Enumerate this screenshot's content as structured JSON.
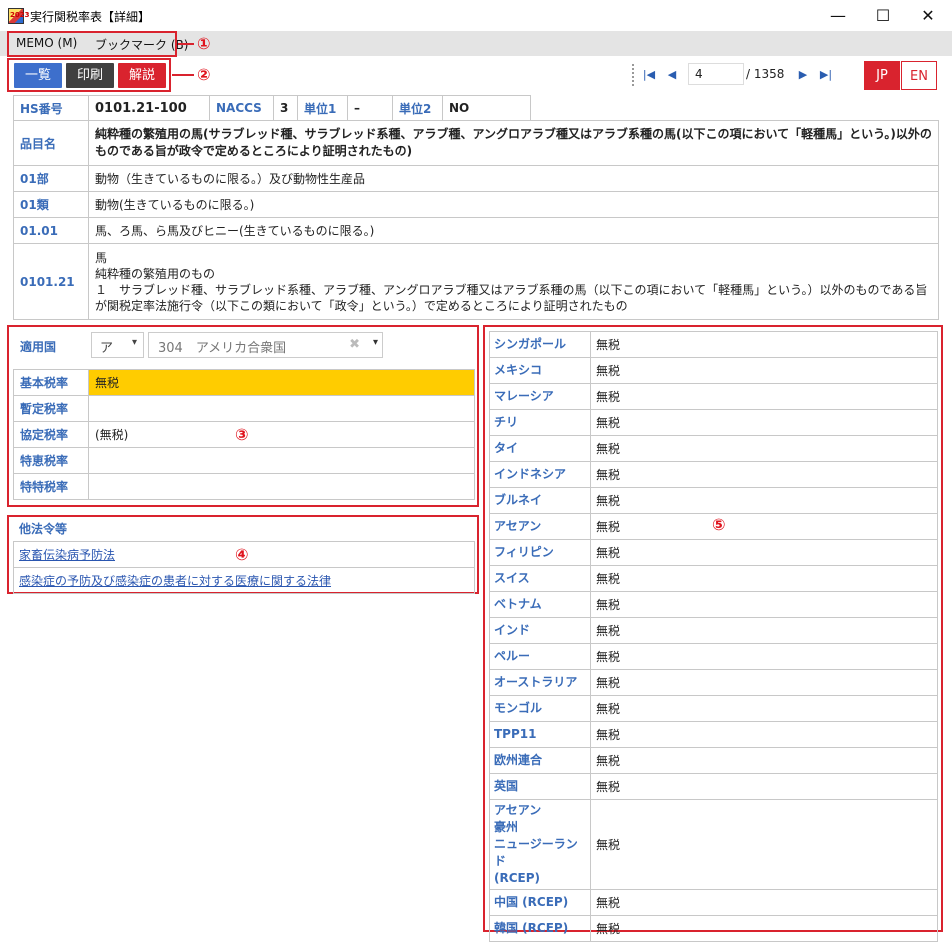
{
  "window": {
    "title": "実行関税率表【詳細】",
    "icon_text": "2023",
    "minimize": "—",
    "maximize": "☐",
    "close": "✕"
  },
  "menu": {
    "memo": "MEMO (M)",
    "bookmark": "ブックマーク (B)"
  },
  "callouts": {
    "c1": "①",
    "c2": "②",
    "c3": "③",
    "c4": "④",
    "c5": "⑤"
  },
  "toolbar": {
    "list": "一覧",
    "print": "印刷",
    "explain": "解説"
  },
  "pager": {
    "current": "4",
    "total": "/ 1358",
    "first": "|◀",
    "prev": "◀",
    "next": "▶",
    "last": "▶|"
  },
  "lang": {
    "jp": "JP",
    "en": "EN"
  },
  "header": {
    "hs_label": "HS番号",
    "hs_value": "0101.21-100",
    "naccs_label": "NACCS",
    "naccs_value": "3",
    "unit1_label": "単位1",
    "unit1_value": "–",
    "unit2_label": "単位2",
    "unit2_value": "NO",
    "item_label": "品目名",
    "item_value": "純粋種の繁殖用の馬(サラブレッド種、サラブレッド系種、アラブ種、アングロアラブ種又はアラブ系種の馬(以下この項において「軽種馬」という。)以外のものである旨が政令で定めるところにより証明されたもの)",
    "rows": [
      {
        "label": "01部",
        "value": "動物（生きているものに限る。）及び動物性生産品"
      },
      {
        "label": "01類",
        "value": "動物(生きているものに限る。)"
      },
      {
        "label": "01.01",
        "value": "馬、ろ馬、ら馬及びヒニー(生きているものに限る。)"
      }
    ],
    "code_label": "0101.21",
    "code_lines": [
      "馬",
      "純粋種の繁殖用のもの",
      "１　サラブレッド種、サラブレッド系種、アラブ種、アングロアラブ種又はアラブ系種の馬（以下この項において「軽種馬」という。）以外のものである旨が関税定率法施行令（以下この類において「政令」という。）で定めるところにより証明されたもの"
    ]
  },
  "country": {
    "label": "適用国",
    "kana": "ア",
    "value": "304　アメリカ合衆国",
    "clear": "✖",
    "dropdown": "▾"
  },
  "rates": [
    {
      "label": "基本税率",
      "value": "無税",
      "highlight": true
    },
    {
      "label": "暫定税率",
      "value": ""
    },
    {
      "label": "協定税率",
      "value": "(無税)"
    },
    {
      "label": "特恵税率",
      "value": ""
    },
    {
      "label": "特特税率",
      "value": ""
    }
  ],
  "laws": {
    "title": "他法令等",
    "items": [
      "家畜伝染病予防法",
      "感染症の予防及び感染症の患者に対する医療に関する法律"
    ]
  },
  "epa": [
    {
      "label": "シンガポール",
      "value": "無税"
    },
    {
      "label": "メキシコ",
      "value": "無税"
    },
    {
      "label": "マレーシア",
      "value": "無税"
    },
    {
      "label": "チリ",
      "value": "無税"
    },
    {
      "label": "タイ",
      "value": "無税"
    },
    {
      "label": "インドネシア",
      "value": "無税"
    },
    {
      "label": "ブルネイ",
      "value": "無税"
    },
    {
      "label": "アセアン",
      "value": "無税"
    },
    {
      "label": "フィリピン",
      "value": "無税"
    },
    {
      "label": "スイス",
      "value": "無税"
    },
    {
      "label": "ベトナム",
      "value": "無税"
    },
    {
      "label": "インド",
      "value": "無税"
    },
    {
      "label": "ペルー",
      "value": "無税"
    },
    {
      "label": "オーストラリア",
      "value": "無税"
    },
    {
      "label": "モンゴル",
      "value": "無税"
    },
    {
      "label": "TPP11",
      "value": "無税"
    },
    {
      "label": "欧州連合",
      "value": "無税"
    },
    {
      "label": "英国",
      "value": "無税"
    },
    {
      "label": "アセアン\n豪州\nニュージーランド\n(RCEP)",
      "value": "無税",
      "tall": true
    },
    {
      "label": "中国 (RCEP)",
      "value": "無税"
    },
    {
      "label": "韓国 (RCEP)",
      "value": "無税"
    }
  ],
  "colors": {
    "accent_red": "#d9232e",
    "label_blue": "#3a6cb8",
    "highlight": "#ffcc00",
    "btn_blue": "#3d6fcc",
    "btn_dark": "#404040"
  }
}
